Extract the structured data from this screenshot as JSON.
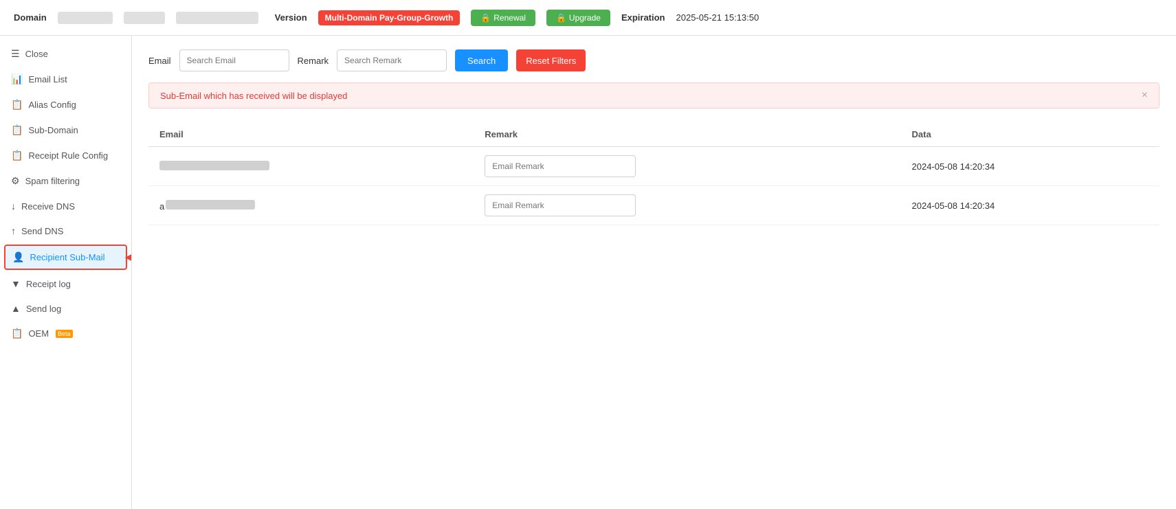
{
  "header": {
    "domain_label": "Domain",
    "domain_value_1": "",
    "domain_value_2": "",
    "version_label": "Version",
    "badge_label": "Multi-Domain Pay-Group-Growth",
    "renewal_label": "Renewal",
    "upgrade_label": "Upgrade",
    "expiration_label": "Expiration",
    "expiration_value": "2025-05-21 15:13:50"
  },
  "sidebar": {
    "items": [
      {
        "id": "close",
        "icon": "≡",
        "label": "Close",
        "active": false
      },
      {
        "id": "email-list",
        "icon": "📊",
        "label": "Email List",
        "active": false
      },
      {
        "id": "alias-config",
        "icon": "📋",
        "label": "Alias Config",
        "active": false
      },
      {
        "id": "sub-domain",
        "icon": "📋",
        "label": "Sub-Domain",
        "active": false
      },
      {
        "id": "receipt-rule-config",
        "icon": "📋",
        "label": "Receipt Rule Config",
        "active": false
      },
      {
        "id": "spam-filtering",
        "icon": "🔧",
        "label": "Spam filtering",
        "active": false
      },
      {
        "id": "receive-dns",
        "icon": "↓",
        "label": "Receive DNS",
        "active": false
      },
      {
        "id": "send-dns",
        "icon": "↑",
        "label": "Send DNS",
        "active": false
      },
      {
        "id": "recipient-sub-mail",
        "icon": "👤",
        "label": "Recipient Sub-Mail",
        "active": true
      },
      {
        "id": "receipt-log",
        "icon": "▼",
        "label": "Receipt log",
        "active": false
      },
      {
        "id": "send-log",
        "icon": "▲",
        "label": "Send log",
        "active": false
      },
      {
        "id": "oem",
        "icon": "📋",
        "label": "OEM",
        "active": false,
        "beta": true
      }
    ]
  },
  "filters": {
    "email_label": "Email",
    "email_placeholder": "Search Email",
    "remark_label": "Remark",
    "remark_placeholder": "Search Remark",
    "search_button": "Search",
    "reset_button": "Reset Filters"
  },
  "alert": {
    "message": "Sub-Email which has received will be displayed"
  },
  "table": {
    "columns": [
      "Email",
      "Remark",
      "Data"
    ],
    "rows": [
      {
        "email": "",
        "remark_placeholder": "Email Remark",
        "date": "2024-05-08 14:20:34"
      },
      {
        "email": "a",
        "remark_placeholder": "Email Remark",
        "date": "2024-05-08 14:20:34"
      }
    ]
  },
  "icons": {
    "lock": "🔒",
    "close_x": "×",
    "user": "👤",
    "bars": "☰",
    "chart": "📊",
    "copy": "📋",
    "gear": "⚙",
    "arrow_down": "↓",
    "arrow_up": "↑",
    "triangle_down": "▼",
    "triangle_up": "▲"
  },
  "colors": {
    "active_blue": "#1890ff",
    "red": "#f44336",
    "green": "#4caf50",
    "alert_bg": "#fff0f0",
    "alert_border": "#ffcccc"
  }
}
